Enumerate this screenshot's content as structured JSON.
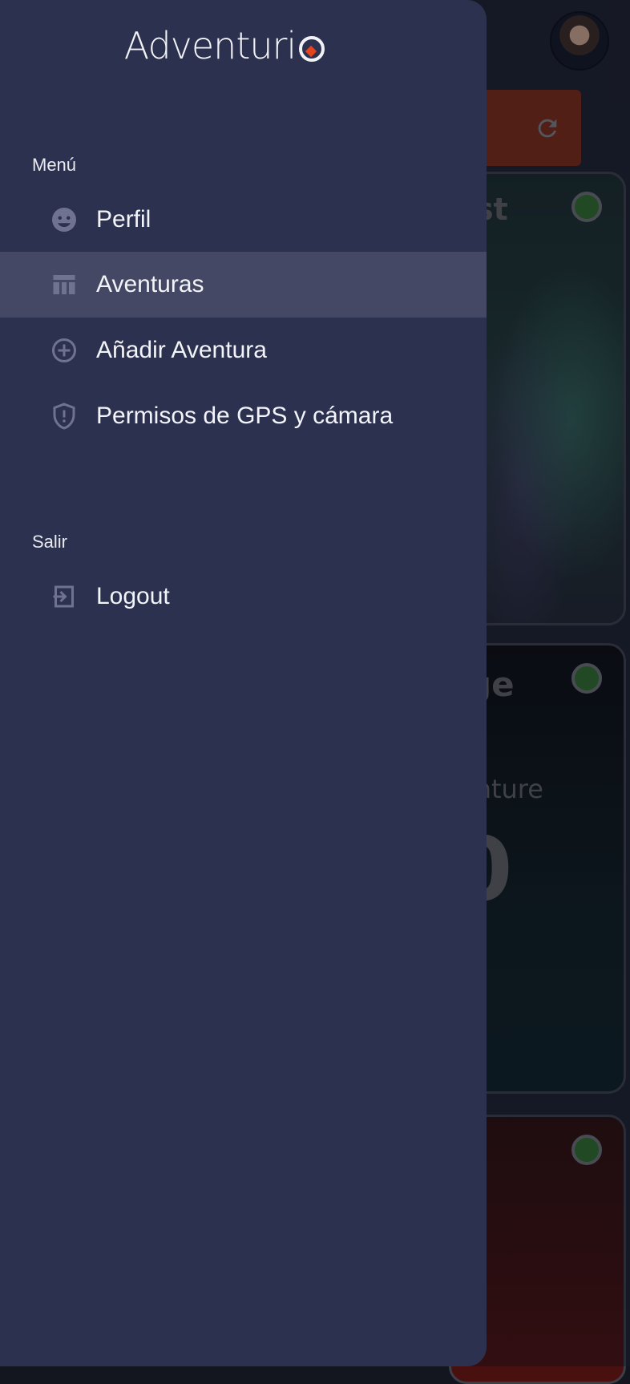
{
  "app": {
    "logo_text": "Adventuri"
  },
  "menu": {
    "section_label": "Menú",
    "items": [
      {
        "label": "Perfil",
        "icon": "face-icon",
        "active": false
      },
      {
        "label": "Aventuras",
        "icon": "table-icon",
        "active": true
      },
      {
        "label": "Añadir Aventura",
        "icon": "add-circle-icon",
        "active": false
      },
      {
        "label": "Permisos de GPS y cámara",
        "icon": "shield-icon",
        "active": false
      }
    ]
  },
  "exit": {
    "section_label": "Salir",
    "items": [
      {
        "label": "Logout",
        "icon": "logout-icon"
      }
    ]
  },
  "background": {
    "card1_title_fragment": "st",
    "card2_title_fragment": "ge",
    "card2_subtitle_fragment": "enture",
    "card2_number_fragment": "0"
  },
  "colors": {
    "drawer_bg": "#2d3150",
    "active_item_bg": "#444864",
    "icon_color": "#6f7390",
    "refresh_button": "#7a2a1a",
    "status_dot": "#2f6b2d"
  }
}
